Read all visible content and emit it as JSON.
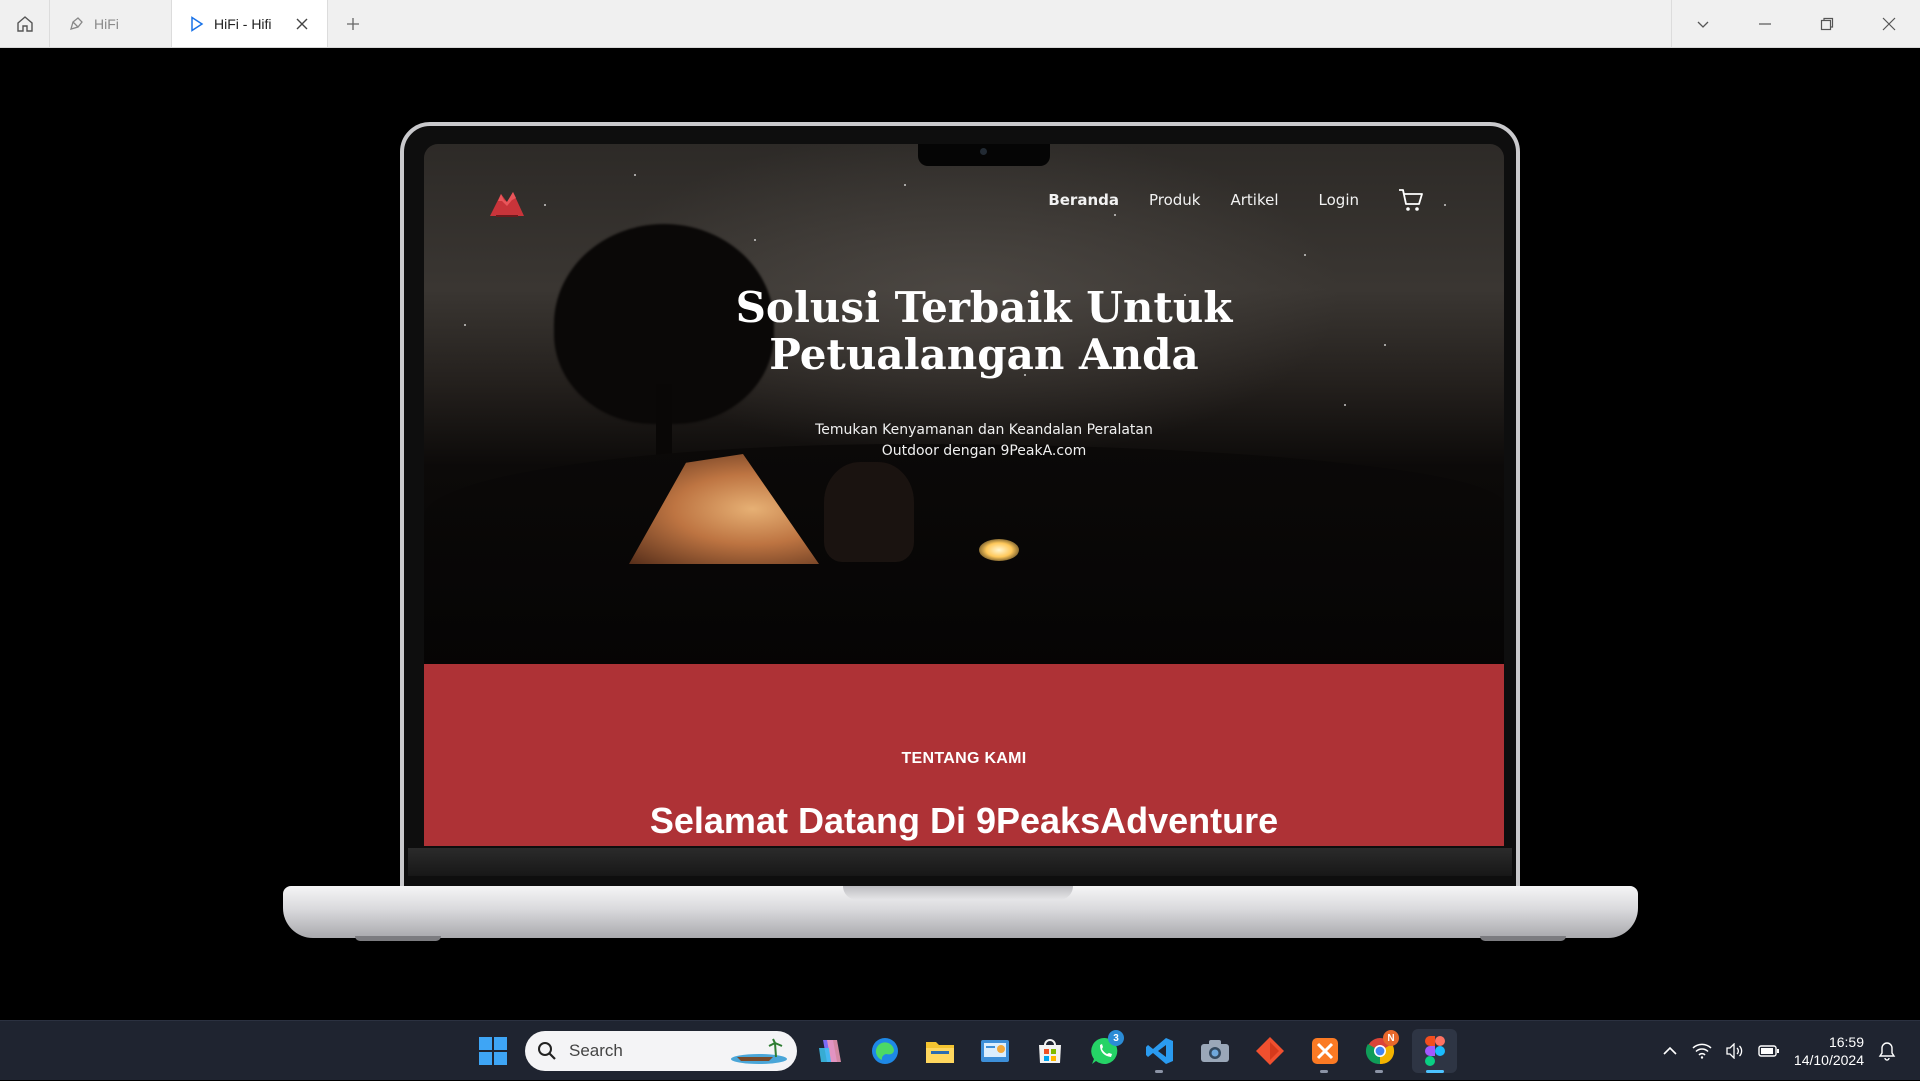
{
  "titlebar": {
    "tabs": [
      {
        "label": "HiFi"
      },
      {
        "label": "HiFi - Hifi"
      }
    ]
  },
  "site": {
    "nav": {
      "links": [
        {
          "label": "Beranda"
        },
        {
          "label": "Produk"
        },
        {
          "label": "Artikel"
        },
        {
          "label": "Login"
        }
      ]
    },
    "hero": {
      "title_line1": "Solusi Terbaik Untuk",
      "title_line2": "Petualangan Anda",
      "subtitle_line1": "Temukan Kenyamanan dan Keandalan Peralatan",
      "subtitle_line2": "Outdoor dengan 9PeakA.com"
    },
    "about": {
      "label": "TENTANG KAMI",
      "title": "Selamat Datang Di 9PeaksAdventure"
    }
  },
  "colors": {
    "brand_red": "#ae3236",
    "accent_blue": "#4cc2ff"
  },
  "taskbar": {
    "search_placeholder": "Search",
    "whatsapp_badge": "3",
    "chrome_badge": "N",
    "time": "16:59",
    "date": "14/10/2024",
    "apps": [
      "start-icon",
      "copilot-icon",
      "edge-icon",
      "file-explorer-icon",
      "control-panel-icon",
      "microsoft-store-icon",
      "whatsapp-icon",
      "vscode-icon",
      "camera-icon",
      "git-icon",
      "xampp-icon",
      "chrome-icon",
      "figma-icon"
    ]
  }
}
